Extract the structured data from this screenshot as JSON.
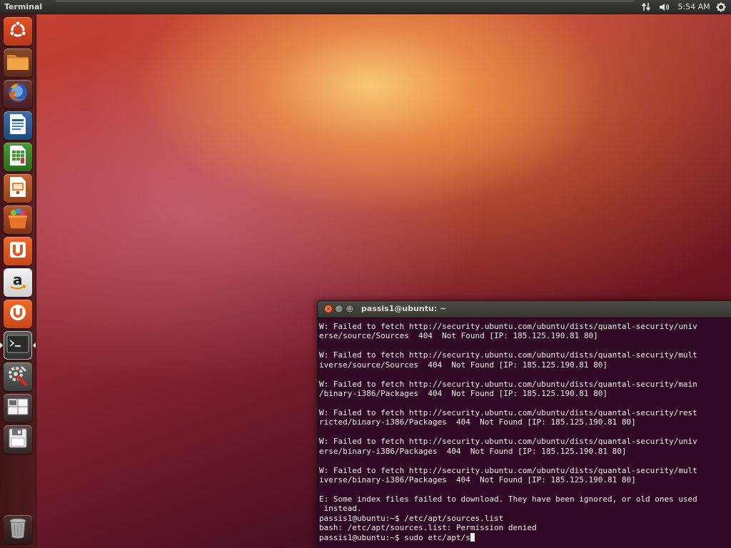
{
  "panel": {
    "title": "Terminal",
    "clock": "5:54 AM",
    "network_icon": "network-arrows-icon",
    "volume_icon": "volume-icon",
    "gear_icon": "session-gear-icon"
  },
  "launcher": {
    "items": [
      {
        "name": "dash-home",
        "icon": "ubuntu-logo-icon"
      },
      {
        "name": "home-folder",
        "icon": "folder-icon"
      },
      {
        "name": "firefox",
        "icon": "firefox-icon"
      },
      {
        "name": "libreoffice-writer",
        "icon": "writer-icon"
      },
      {
        "name": "libreoffice-calc",
        "icon": "calc-icon"
      },
      {
        "name": "libreoffice-impress",
        "icon": "impress-icon"
      },
      {
        "name": "ubuntu-software-center",
        "icon": "software-center-bag-icon"
      },
      {
        "name": "ubuntu-one",
        "icon": "ubuntu-one-icon"
      },
      {
        "name": "amazon",
        "icon": "amazon-icon"
      },
      {
        "name": "ubuntu-one-music",
        "icon": "ubuntu-one-music-icon"
      },
      {
        "name": "terminal",
        "icon": "terminal-icon"
      },
      {
        "name": "system-settings",
        "icon": "settings-wrench-icon"
      },
      {
        "name": "workspace-switcher",
        "icon": "workspace-switcher-icon"
      },
      {
        "name": "removable-drive",
        "icon": "floppy-drive-icon"
      },
      {
        "name": "trash",
        "icon": "trash-icon"
      }
    ]
  },
  "terminal": {
    "title": "passis1@ubuntu: ~",
    "close_glyph": "×",
    "min_glyph": "–",
    "max_glyph": "□",
    "lines": [
      "W: Failed to fetch http://security.ubuntu.com/ubuntu/dists/quantal-security/univ",
      "erse/source/Sources  404  Not Found [IP: 185.125.190.81 80]",
      "",
      "W: Failed to fetch http://security.ubuntu.com/ubuntu/dists/quantal-security/mult",
      "iverse/source/Sources  404  Not Found [IP: 185.125.190.81 80]",
      "",
      "W: Failed to fetch http://security.ubuntu.com/ubuntu/dists/quantal-security/main",
      "/binary-i386/Packages  404  Not Found [IP: 185.125.190.81 80]",
      "",
      "W: Failed to fetch http://security.ubuntu.com/ubuntu/dists/quantal-security/rest",
      "ricted/binary-i386/Packages  404  Not Found [IP: 185.125.190.81 80]",
      "",
      "W: Failed to fetch http://security.ubuntu.com/ubuntu/dists/quantal-security/univ",
      "erse/binary-i386/Packages  404  Not Found [IP: 185.125.190.81 80]",
      "",
      "W: Failed to fetch http://security.ubuntu.com/ubuntu/dists/quantal-security/mult",
      "iverse/binary-i386/Packages  404  Not Found [IP: 185.125.190.81 80]",
      "",
      "E: Some index files failed to download. They have been ignored, or old ones used",
      " instead.",
      "passis1@ubuntu:~$ /etc/apt/sources.list",
      "bash: /etc/apt/sources.list: Permission denied"
    ],
    "prompt_line": "passis1@ubuntu:~$ sudo etc/apt/s"
  },
  "colors": {
    "terminal_bg": "#300a24",
    "terminal_fg": "#eeeeec",
    "panel_bg": "#3c3b37",
    "close_button": "#df4a16"
  }
}
